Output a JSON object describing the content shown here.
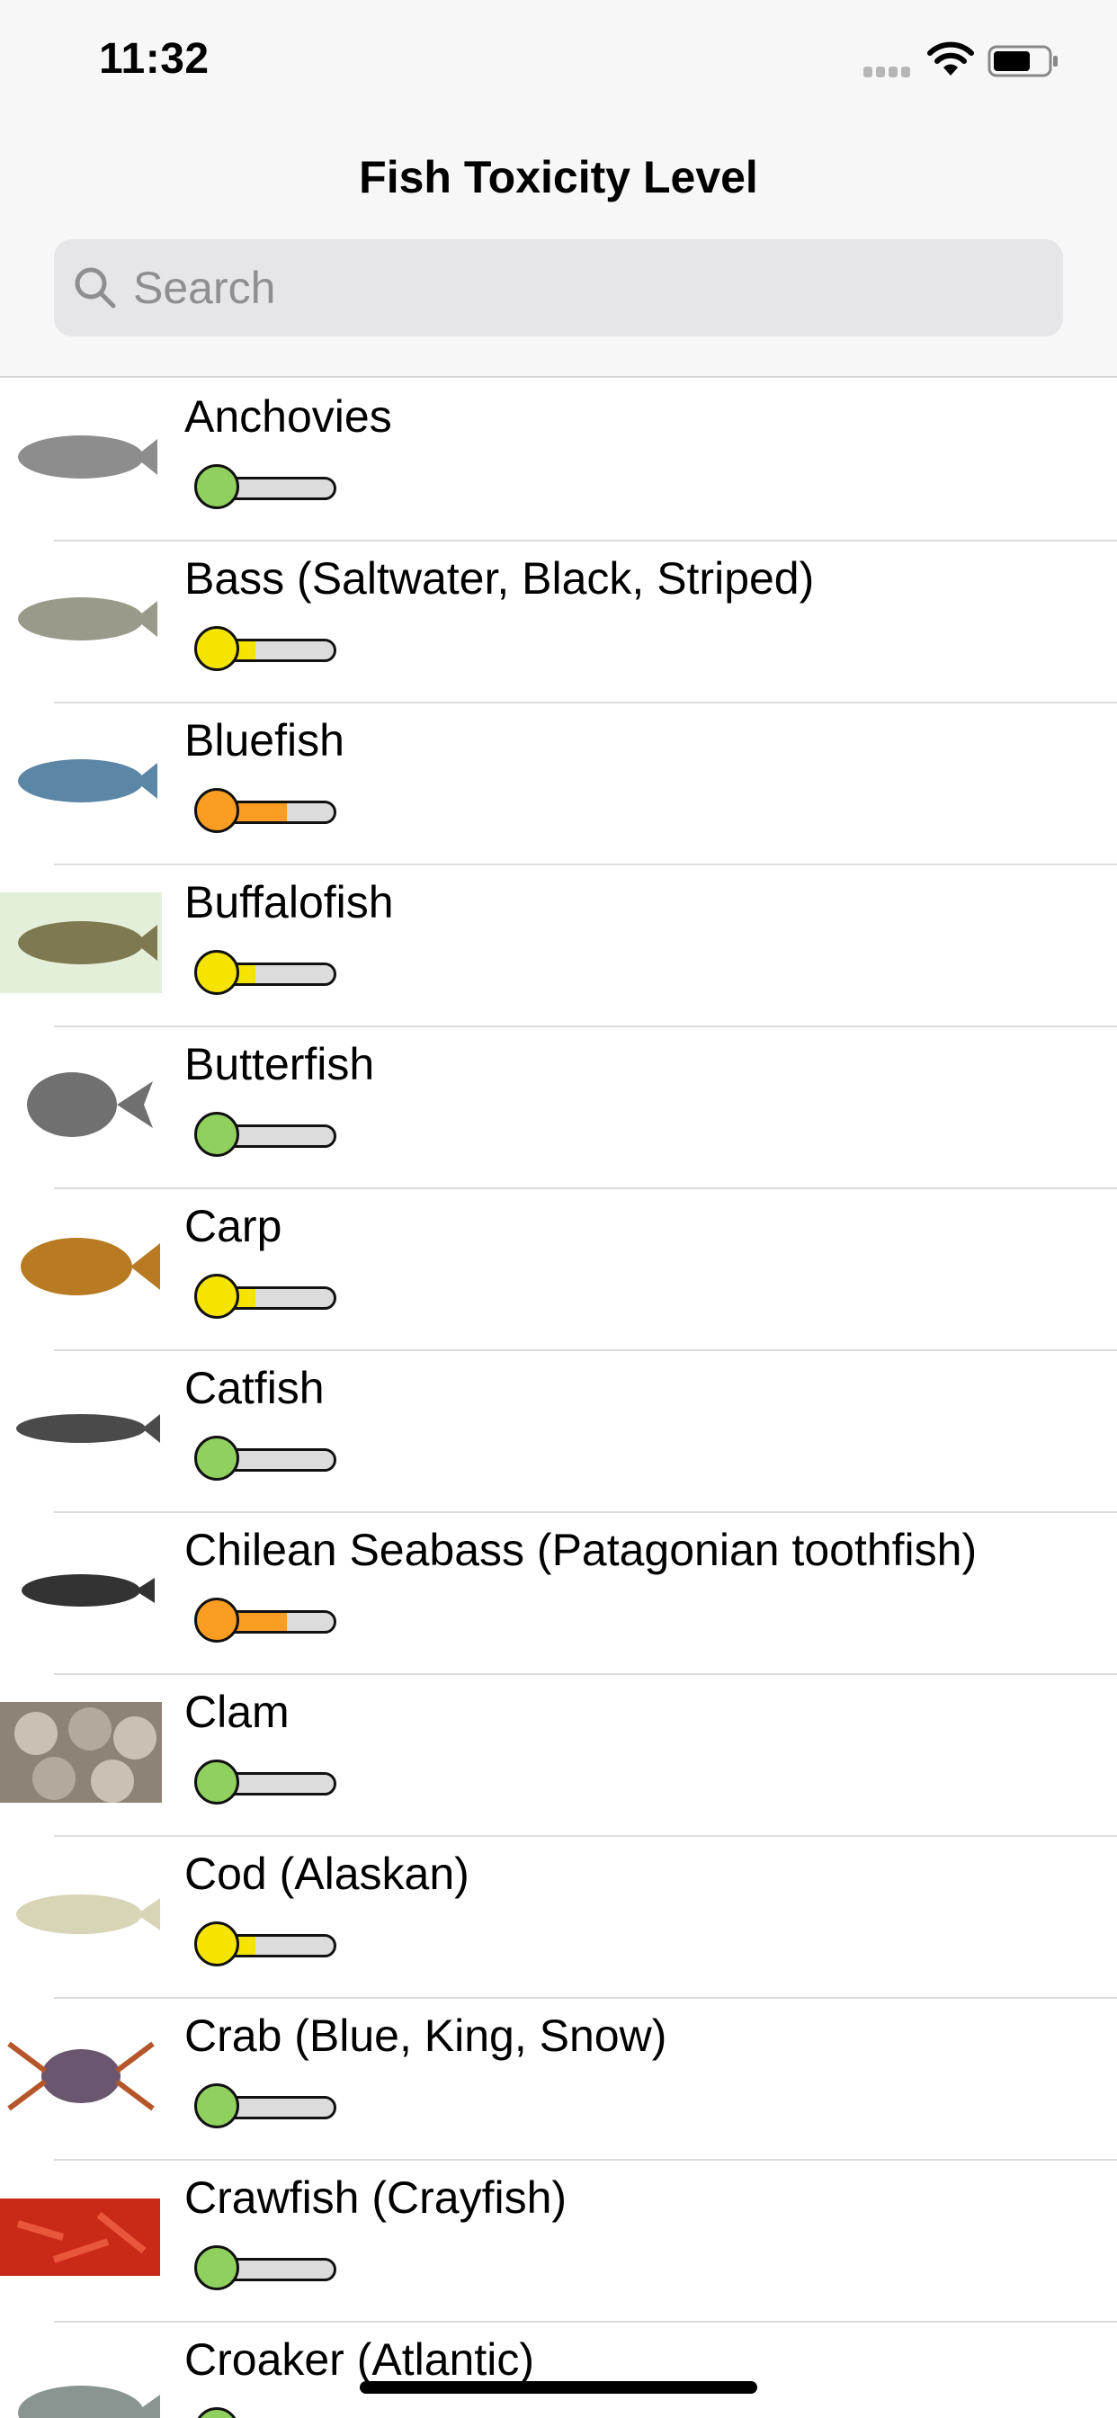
{
  "status_bar": {
    "time": "11:32"
  },
  "nav": {
    "title": "Fish Toxicity Level"
  },
  "search": {
    "placeholder": "Search",
    "value": ""
  },
  "level_colors": {
    "low": "#8fd05f",
    "medium": "#f5e400",
    "high": "#fb9d22"
  },
  "fish": [
    {
      "name": "Anchovies",
      "level": "low",
      "thumb": "#8d8d8d"
    },
    {
      "name": "Bass (Saltwater, Black, Striped)",
      "level": "medium",
      "thumb": "#9a9a8a"
    },
    {
      "name": "Bluefish",
      "level": "high",
      "thumb": "#5b86a6"
    },
    {
      "name": "Buffalofish",
      "level": "medium",
      "thumb": "#7e7950"
    },
    {
      "name": "Butterfish",
      "level": "low",
      "thumb": "#707070"
    },
    {
      "name": "Carp",
      "level": "medium",
      "thumb": "#b87a22"
    },
    {
      "name": "Catfish",
      "level": "low",
      "thumb": "#4a4a4a"
    },
    {
      "name": "Chilean Seabass (Patagonian toothfish)",
      "level": "high",
      "thumb": "#333333"
    },
    {
      "name": "Clam",
      "level": "low",
      "thumb": "#8d8377"
    },
    {
      "name": "Cod (Alaskan)",
      "level": "medium",
      "thumb": "#d8d4b6"
    },
    {
      "name": "Crab (Blue, King, Snow)",
      "level": "low",
      "thumb": "#6b5670"
    },
    {
      "name": "Crawfish (Crayfish)",
      "level": "low",
      "thumb": "#c92a17"
    },
    {
      "name": "Croaker (Atlantic)",
      "level": "low",
      "thumb": "#8a9591"
    }
  ]
}
